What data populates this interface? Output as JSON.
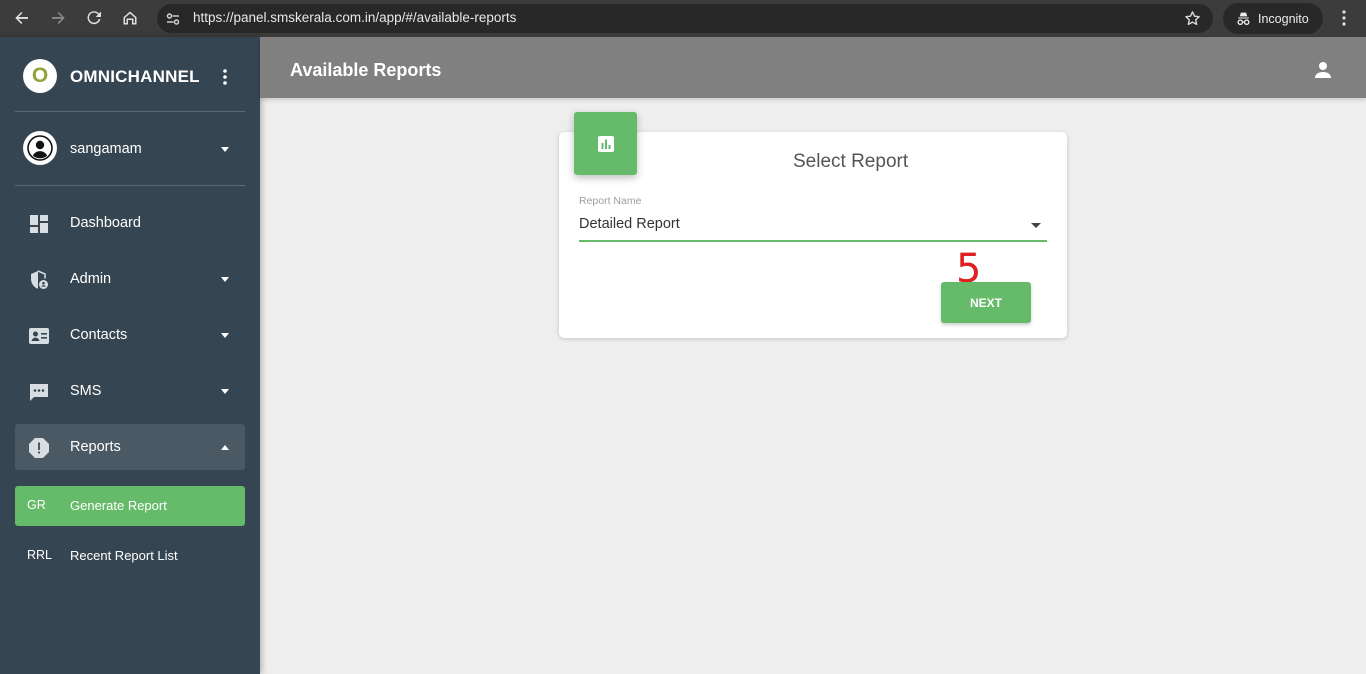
{
  "browser": {
    "url": "https://panel.smskerala.com.in/app/#/available-reports",
    "incognito_label": "Incognito"
  },
  "sidebar": {
    "logo_letter": "O",
    "brand_name": "OMNICHANNEL",
    "user_name": "sangamam",
    "items": [
      {
        "label": "Dashboard",
        "icon": "dashboard-icon"
      },
      {
        "label": "Admin",
        "icon": "admin-shield-icon"
      },
      {
        "label": "Contacts",
        "icon": "contacts-icon"
      },
      {
        "label": "SMS",
        "icon": "sms-icon"
      },
      {
        "label": "Reports",
        "icon": "reports-icon"
      }
    ],
    "sub_items": [
      {
        "abbr": "GR",
        "label": "Generate Report"
      },
      {
        "abbr": "RRL",
        "label": "Recent Report List"
      }
    ]
  },
  "header": {
    "title": "Available Reports"
  },
  "card": {
    "title": "Select Report",
    "field_label": "Report Name",
    "field_value": "Detailed Report",
    "annotation": "5",
    "next_label": "NEXT"
  },
  "colors": {
    "accent": "#66bb6a",
    "sidebar": "#354551",
    "header": "#808080",
    "annotation": "#e02020"
  }
}
